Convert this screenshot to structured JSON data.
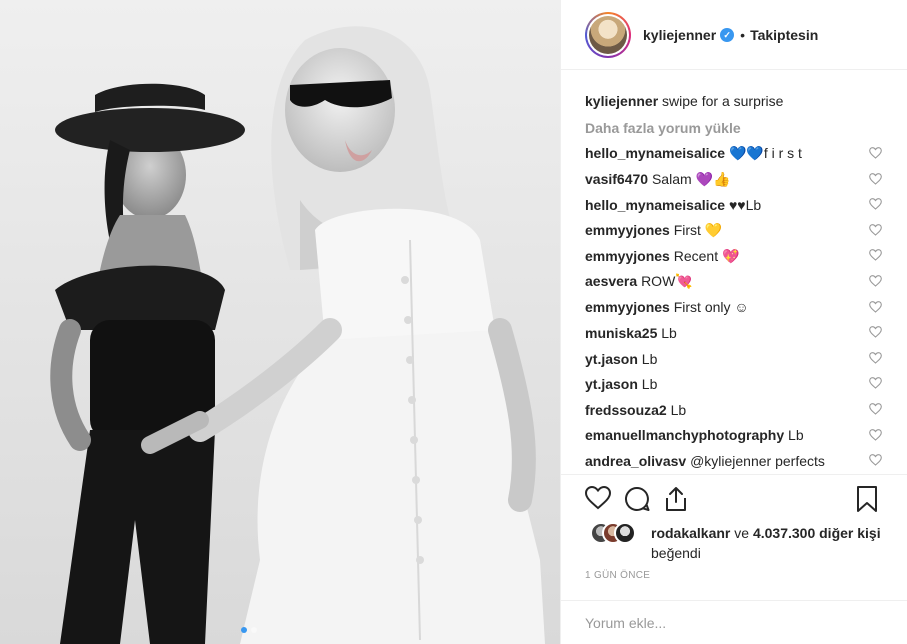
{
  "post": {
    "username": "kyliejenner",
    "separator": "•",
    "follow_status": "Takiptesin",
    "caption_user": "kyliejenner",
    "caption_text": "swipe for a surprise",
    "load_more": "Daha fazla yorum yükle",
    "carousel": {
      "slides": 2,
      "active_index": 0
    }
  },
  "comments": [
    {
      "user": "hello_mynameisalice",
      "text": "💙💙f i r s t"
    },
    {
      "user": "vasif6470",
      "text": "Salam 💜👍"
    },
    {
      "user": "hello_mynameisalice",
      "text": "♥♥Lb"
    },
    {
      "user": "emmyyjones",
      "text": "First 💛"
    },
    {
      "user": "emmyyjones",
      "text": "Recent 💖"
    },
    {
      "user": "aesvera",
      "text": "ROW💘"
    },
    {
      "user": "emmyyjones",
      "text": "First only ☺"
    },
    {
      "user": "muniska25",
      "text": "Lb"
    },
    {
      "user": "yt.jason",
      "text": "Lb"
    },
    {
      "user": "yt.jason",
      "text": "Lb"
    },
    {
      "user": "fredssouza2",
      "text": "Lb"
    },
    {
      "user": "emanuellmanchyphotography",
      "text": "Lb"
    },
    {
      "user": "andrea_olivasv",
      "text": "@kyliejenner perfects"
    }
  ],
  "likes": {
    "first_liker": "rodakalkanr",
    "connector": "ve",
    "count_text": "4.037.300 diğer kişi",
    "suffix": "beğendi"
  },
  "timestamp": "1 GÜN ÖNCE",
  "comment_input": {
    "placeholder": "Yorum ekle..."
  },
  "colors": {
    "accent": "#3897f0",
    "muted": "#999999",
    "border": "#efefef",
    "text": "#262626"
  },
  "icons": [
    "heart-icon",
    "comment-icon",
    "share-icon",
    "bookmark-icon",
    "verified-badge-icon"
  ]
}
